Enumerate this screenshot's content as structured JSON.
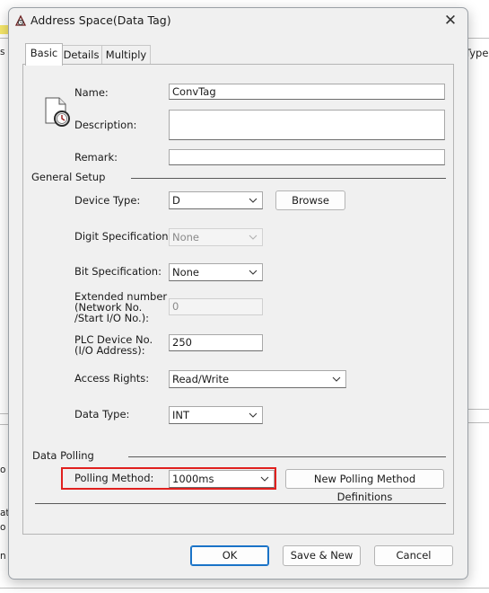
{
  "window": {
    "title": "Address Space(Data Tag)",
    "close_glyph": "✕"
  },
  "background": {
    "right_header": "Type",
    "left_fragments": [
      "s",
      "o",
      "at",
      "o",
      "n"
    ]
  },
  "tabs": [
    {
      "label": "Basic",
      "active": true
    },
    {
      "label": "Details",
      "active": false
    },
    {
      "label": "Multiply",
      "active": false
    }
  ],
  "basic": {
    "icon": "document-clock-icon",
    "name_label": "Name:",
    "name_value": "ConvTag",
    "description_label": "Description:",
    "description_value": "",
    "remark_label": "Remark:",
    "remark_value": ""
  },
  "general_setup": {
    "title": "General Setup",
    "device_type_label": "Device Type:",
    "device_type_value": "D",
    "browse_label": "Browse",
    "digit_spec_label": "Digit Specification:",
    "digit_spec_value": "None",
    "bit_spec_label": "Bit Specification:",
    "bit_spec_value": "None",
    "extended_label_1": "Extended number",
    "extended_label_2": "(Network No.",
    "extended_label_3": "/Start I/O No.):",
    "extended_value": "0",
    "plc_device_label_1": "PLC Device No.",
    "plc_device_label_2": "(I/O Address):",
    "plc_device_value": "250",
    "access_rights_label": "Access Rights:",
    "access_rights_value": "Read/Write",
    "data_type_label": "Data Type:",
    "data_type_value": "INT"
  },
  "data_polling": {
    "title": "Data Polling",
    "polling_method_label": "Polling Method:",
    "polling_method_value": "1000ms",
    "new_definitions_label": "New Polling Method Definitions"
  },
  "footer": {
    "ok_label": "OK",
    "save_new_label": "Save & New",
    "cancel_label": "Cancel"
  },
  "colors": {
    "highlight": "#e0201e",
    "primary_border": "#1a73c7"
  }
}
